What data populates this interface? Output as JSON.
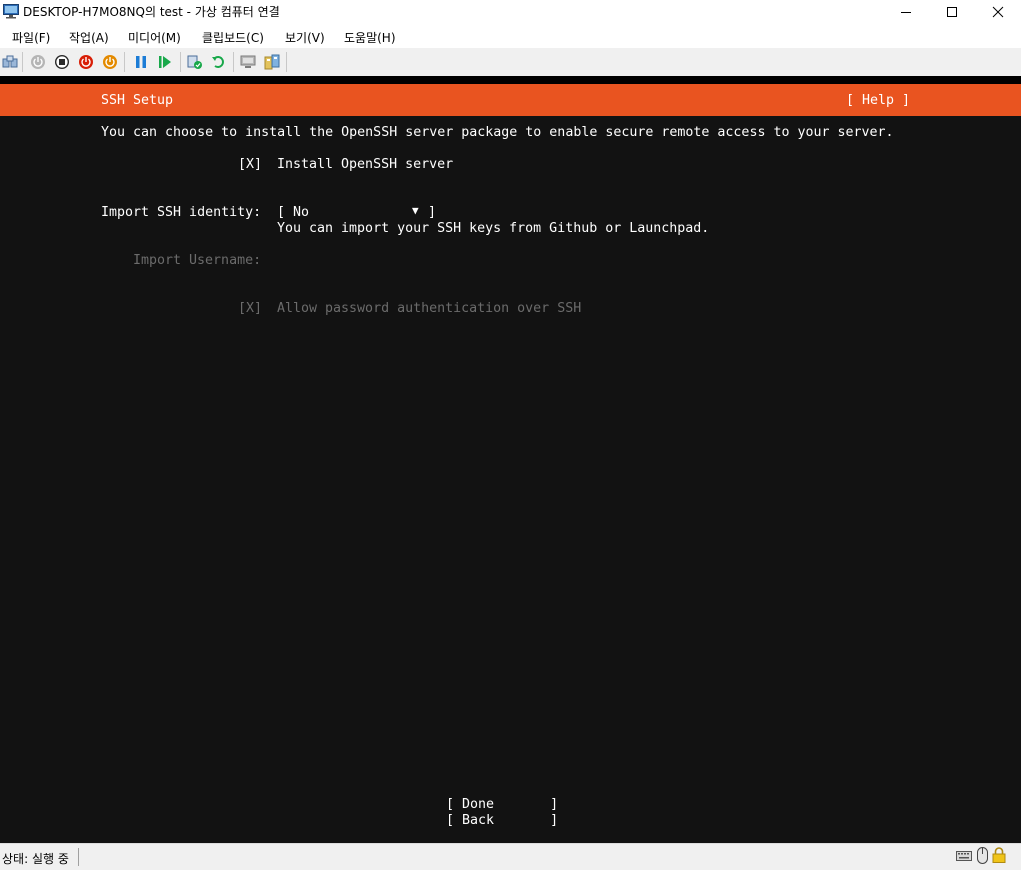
{
  "window": {
    "title": "DESKTOP-H7MO8NQ의 test - 가상 컴퓨터 연결",
    "controls": {
      "minimize": "—",
      "maximize": "☐",
      "close": "✕"
    }
  },
  "menubar": {
    "items": [
      "파일(F)",
      "작업(A)",
      "미디어(M)",
      "클립보드(C)",
      "보기(V)",
      "도움말(H)"
    ]
  },
  "toolbar": {
    "icons": [
      "ctrl-alt-del-icon",
      "start-icon",
      "turn-off-icon",
      "shut-down-icon",
      "save-icon",
      "pause-icon",
      "resume-icon",
      "checkpoint-icon",
      "revert-icon",
      "enhanced-session-icon",
      "share-icon"
    ],
    "colors": {
      "red": "#d81e06",
      "orange": "#e38a00",
      "blue": "#1c7cd6",
      "green": "#18a84a"
    }
  },
  "installer": {
    "header_title": "SSH Setup",
    "help": "[ Help ]",
    "intro": "You can choose to install the OpenSSH server package to enable secure remote access to your server.",
    "install_checkbox": "[X]",
    "install_label": "Install OpenSSH server",
    "import_label": "Import SSH identity:",
    "import_open": "[ No",
    "import_arrow": "▼",
    "import_close": "]",
    "import_help": "You can import your SSH keys from Github or Launchpad.",
    "username_label": "Import Username:",
    "password_checkbox": "[X]",
    "password_label": "Allow password authentication over SSH",
    "done_button": "[ Done       ]",
    "back_button": "[ Back       ]",
    "colors": {
      "accent": "#e95420",
      "background": "#121212",
      "text": "#ffffff",
      "disabled": "#6b6b6b"
    }
  },
  "statusbar": {
    "status": "상태: 실행 중",
    "icons": [
      "keyboard-icon",
      "mouse-icon",
      "lock-icon"
    ]
  }
}
